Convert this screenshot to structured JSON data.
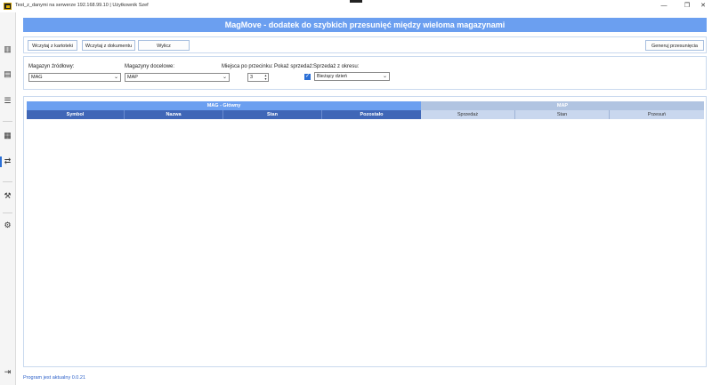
{
  "window": {
    "title": "Test_z_danymi na serwerze 192.168.99.10 | Użytkownik Szef",
    "minimize_glyph": "—",
    "maximize_glyph": "❐",
    "close_glyph": "✕"
  },
  "sidebar": {
    "icons": [
      "bar-chart-icon",
      "bar-chart-alt-icon",
      "list-icon",
      "grid-add-icon",
      "warehouse-move-icon",
      "tools-icon",
      "settings-icon",
      "logout-icon"
    ],
    "glyphs": {
      "bar_chart": "▥",
      "bar_chart_alt": "▤",
      "list": "☰",
      "grid_add": "▦",
      "move": "⇄",
      "tools": "⚒",
      "settings": "⚙",
      "logout": "⇥"
    }
  },
  "header": {
    "title": "MagMove  - dodatek do szybkich przesunięć między wieloma magazynami"
  },
  "toolbar": {
    "load_from_cards": "Wczytaj z kartoteki",
    "load_from_document": "Wczytaj z dokumentu",
    "clear": "Wylicz",
    "generate": "Generuj przesunięcia"
  },
  "filters": {
    "source_label": "Magazyn źródłowy:",
    "source_value": "MAG",
    "target_label": "Magazyny docelowe:",
    "target_value": "MAP",
    "decimals_label": "Miejsca po przecinku:",
    "decimals_value": "3",
    "show_sales_label": "Pokaż sprzedaż:",
    "show_sales_checked": true,
    "sales_period_label": "Sprzedaż z okresu:",
    "sales_period_value": "Bieżący dzień"
  },
  "grid": {
    "source_group": "MAG - Główny",
    "target_group": "MAP",
    "source_columns": [
      "Symbol",
      "Nazwa",
      "Stan",
      "Pozostało"
    ],
    "target_columns": [
      "Sprzedaż",
      "Stan",
      "Przesuń"
    ],
    "colors": {
      "source_group_bg": "#6b9ff0",
      "source_col_bg": "#3f66b7",
      "target_group_bg": "#b1c4e1",
      "target_col_bg": "#c9d7ee"
    }
  },
  "status": {
    "text": "Program jest aktualny 0.0.21"
  }
}
